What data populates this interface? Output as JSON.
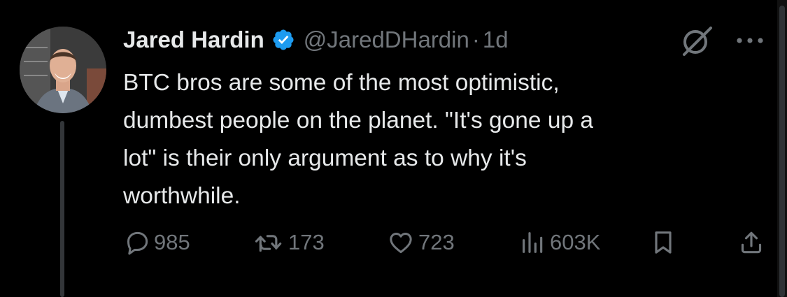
{
  "tweet": {
    "author_name": "Jared Hardin",
    "handle": "@JaredDHardin",
    "separator": "·",
    "time": "1d",
    "text": "BTC bros are some of the most optimistic,\ndumbest people on the planet.  \"It's gone up a\nlot\" is their only argument as to why it's\nworthwhile."
  },
  "actions": {
    "replies": "985",
    "reposts": "173",
    "likes": "723",
    "views": "603K"
  },
  "icons": {
    "verified": "verified-badge-icon",
    "grok": "grok-icon",
    "more": "more-dots-icon",
    "reply": "reply-icon",
    "repost": "repost-icon",
    "like": "heart-icon",
    "views": "views-chart-icon",
    "bookmark": "bookmark-icon",
    "share": "share-icon"
  },
  "colors": {
    "background": "#000000",
    "text_primary": "#e7e9ea",
    "text_secondary": "#71767b",
    "verified_blue": "#1d9bf0",
    "thread_line": "#333639"
  }
}
